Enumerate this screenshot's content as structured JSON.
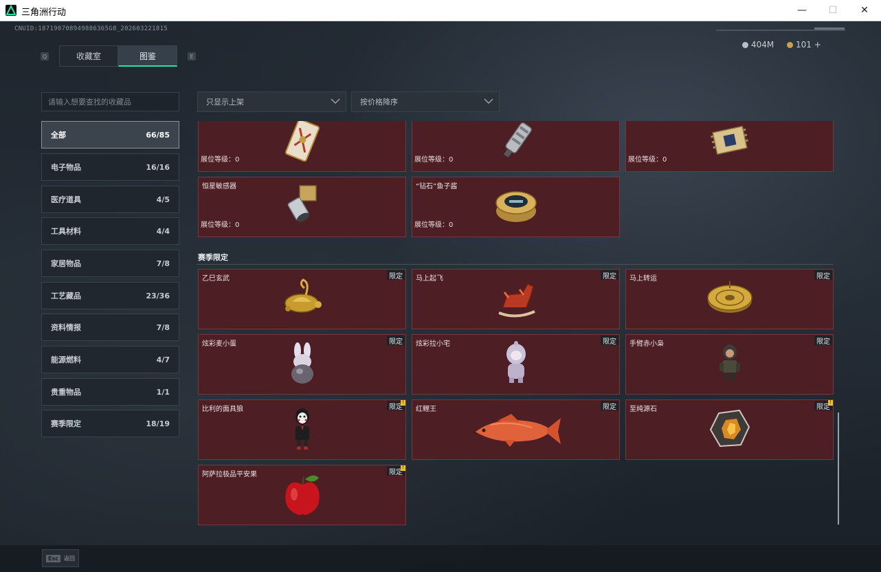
{
  "window": {
    "title": "三角洲行动",
    "minimize": "—",
    "maximize": "☐",
    "close": "✕"
  },
  "header": {
    "uid": "CNUID:187190708949886365G8_202603221815",
    "currency": [
      {
        "value": "404M",
        "color": "#b8bec4"
      },
      {
        "value": "101 +",
        "color": "#c9a24a"
      }
    ],
    "key_left": "Q",
    "key_right": "E",
    "tabs": [
      {
        "label": "收藏室",
        "active": false
      },
      {
        "label": "图鉴",
        "active": true
      }
    ]
  },
  "search": {
    "placeholder": "请输入想要查找的收藏品"
  },
  "filters": [
    {
      "label": "只显示上架"
    },
    {
      "label": "按价格降序"
    }
  ],
  "categories": [
    {
      "label": "全部",
      "count": "66/85",
      "active": true
    },
    {
      "label": "电子物品",
      "count": "16/16"
    },
    {
      "label": "医疗道具",
      "count": "4/5"
    },
    {
      "label": "工具材料",
      "count": "4/4"
    },
    {
      "label": "家居物品",
      "count": "7/8"
    },
    {
      "label": "工艺藏品",
      "count": "23/36"
    },
    {
      "label": "资料情报",
      "count": "7/8"
    },
    {
      "label": "能源燃料",
      "count": "4/7"
    },
    {
      "label": "贵重物品",
      "count": "1/1"
    },
    {
      "label": "赛季限定",
      "count": "18/19"
    }
  ],
  "level_label": "展位等级：0",
  "top_items": [
    {
      "name": "",
      "icon": "card-icon"
    },
    {
      "name": "",
      "icon": "canister-icon"
    },
    {
      "name": "",
      "icon": "circuit-icon"
    },
    {
      "name": "恒星敏感器",
      "icon": "sensor-icon"
    },
    {
      "name": "“钻石”鱼子酱",
      "icon": "caviar-icon"
    }
  ],
  "season_section": {
    "title": "赛季限定",
    "limited_label": "限定",
    "items": [
      {
        "name": "乙巳玄武",
        "icon": "golden-turtle-icon",
        "new": false
      },
      {
        "name": "马上起飞",
        "icon": "rocking-horse-icon",
        "new": false
      },
      {
        "name": "马上转运",
        "icon": "golden-compass-icon",
        "new": false
      },
      {
        "name": "炫彩麦小蛋",
        "icon": "bunny-egg-icon",
        "new": false
      },
      {
        "name": "炫彩拉小宅",
        "icon": "hooded-doll-icon",
        "new": false
      },
      {
        "name": "手臂赤小枭",
        "icon": "soldier-figure-icon",
        "new": false
      },
      {
        "name": "比利的面具狼",
        "icon": "puppet-icon",
        "new": true
      },
      {
        "name": "红鲤王",
        "icon": "red-carp-icon",
        "new": false
      },
      {
        "name": "至纯源石",
        "icon": "ore-stone-icon",
        "new": true
      },
      {
        "name": "阿萨拉极品平安果",
        "icon": "red-apple-icon",
        "new": true
      }
    ]
  },
  "new_mark": "!",
  "footer": {
    "esc_key": "Esc",
    "esc_label": "返回"
  }
}
